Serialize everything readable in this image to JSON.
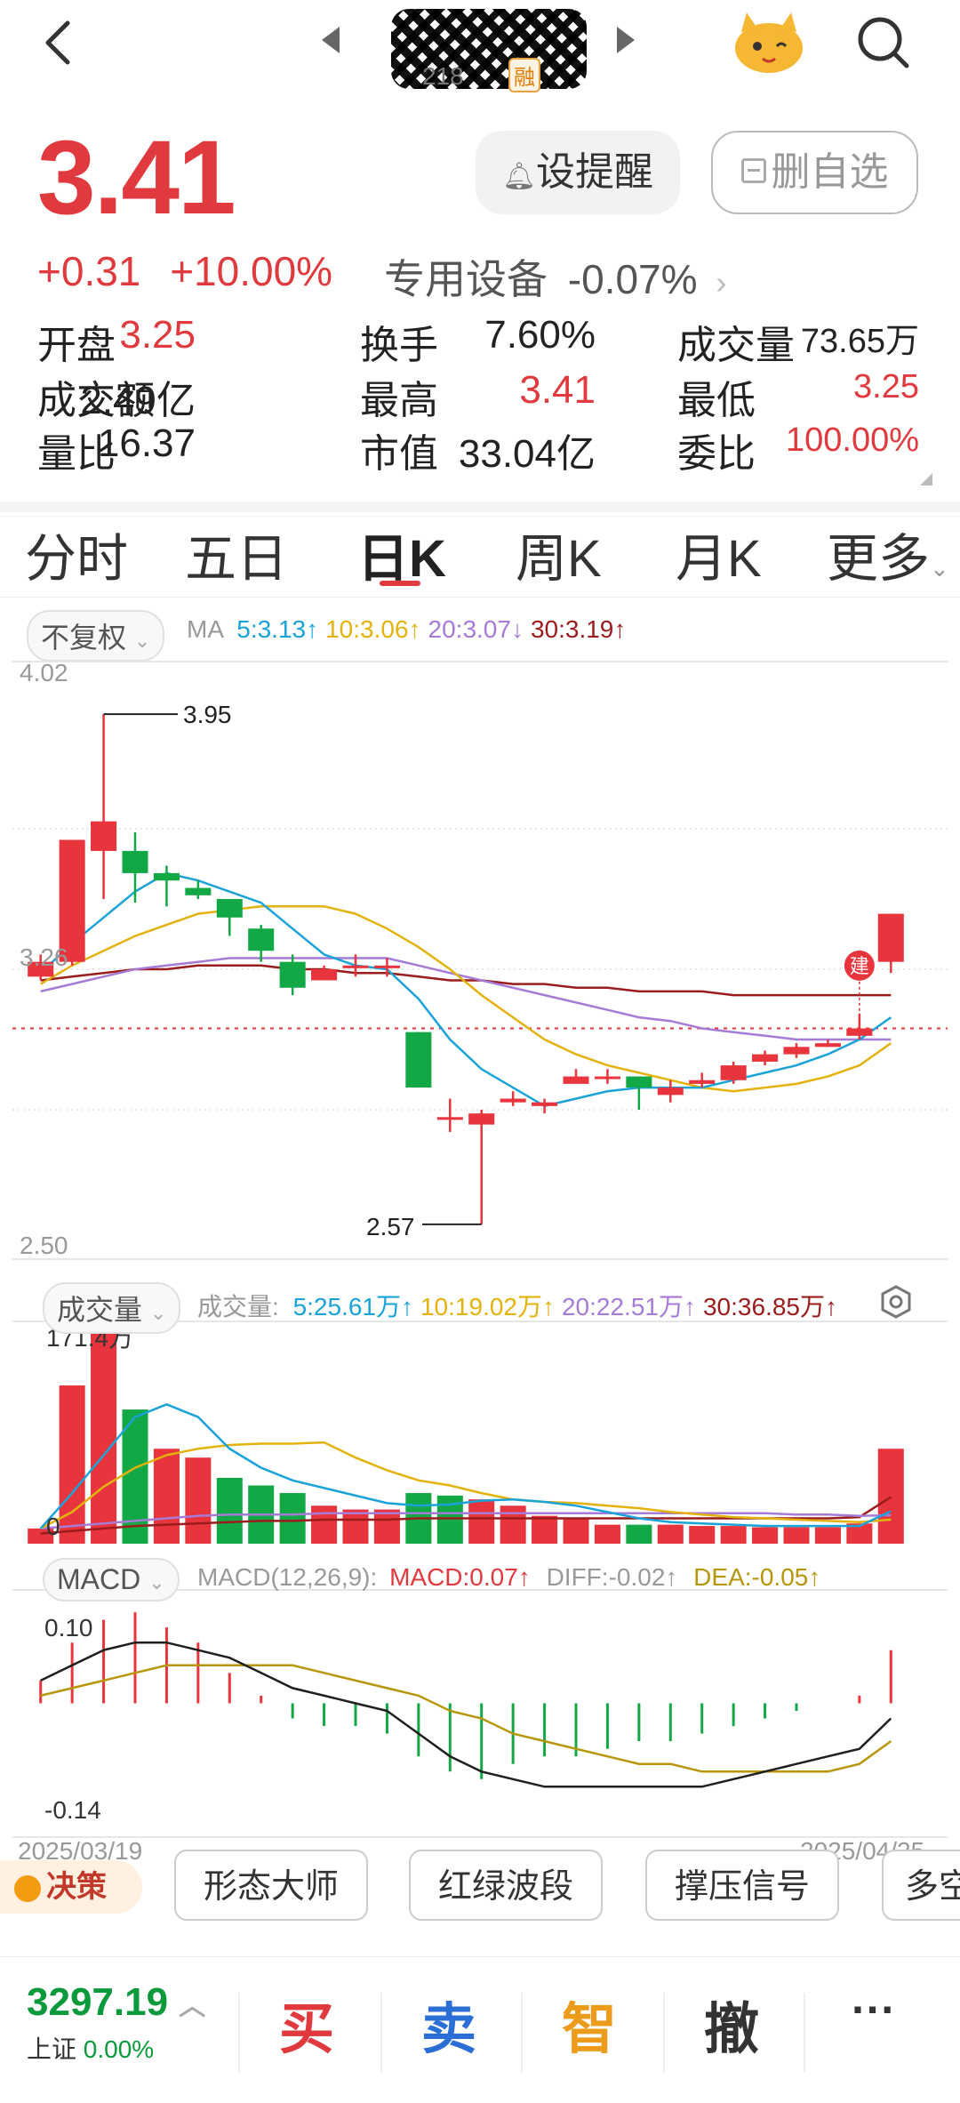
{
  "header": {
    "code_label": "218",
    "rong_badge": "融"
  },
  "quote": {
    "price": "3.41",
    "change": "+0.31",
    "change_pct": "+10.00%",
    "sector": "专用设备",
    "sector_change": "-0.07%",
    "alert_button": "设提醒",
    "remove_button": "删自选"
  },
  "stats": [
    {
      "label": "开盘",
      "value": "3.25",
      "color": "#e03a3e"
    },
    {
      "label": "换手",
      "value": "7.60%",
      "color": "#222222"
    },
    {
      "label": "成交量",
      "value": "73.65万",
      "color": "#222222"
    },
    {
      "label": "成交额",
      "value": "2.49亿",
      "color": "#222222"
    },
    {
      "label": "最高",
      "value": "3.41",
      "color": "#e03a3e"
    },
    {
      "label": "最低",
      "value": "3.25",
      "color": "#e03a3e"
    },
    {
      "label": "量比",
      "value": "16.37",
      "color": "#222222"
    },
    {
      "label": "市值",
      "value": "33.04亿",
      "color": "#222222"
    },
    {
      "label": "委比",
      "value": "100.00%",
      "color": "#e03a3e"
    }
  ],
  "tabs": [
    "分时",
    "五日",
    "日K",
    "周K",
    "月K",
    "更多"
  ],
  "kline": {
    "adjust_label": "不复权",
    "ma_prefix": "MA",
    "ma": [
      {
        "label": "5:3.13",
        "arrow": "↑",
        "color": "#1aa3d9"
      },
      {
        "label": "10:3.06",
        "arrow": "↑",
        "color": "#e3b20c"
      },
      {
        "label": "20:3.07",
        "arrow": "↓",
        "color": "#a57bd6"
      },
      {
        "label": "30:3.19",
        "arrow": "↑",
        "color": "#9b1c1c"
      }
    ],
    "y_max": "4.02",
    "y_mid": "3.26",
    "y_min": "2.50",
    "high_label": "3.95",
    "low_label": "2.57",
    "build_marker": "建"
  },
  "volume": {
    "selector": "成交量",
    "prefix": "成交量:",
    "ma": [
      {
        "label": "5:25.61万",
        "arrow": "↑",
        "color": "#1aa3d9"
      },
      {
        "label": "10:19.02万",
        "arrow": "↑",
        "color": "#e3b20c"
      },
      {
        "label": "20:22.51万",
        "arrow": "↑",
        "color": "#a57bd6"
      },
      {
        "label": "30:36.85万",
        "arrow": "↑",
        "color": "#9b1c1c"
      }
    ],
    "max_label": "171.4万",
    "zero_label": "0"
  },
  "macd": {
    "selector": "MACD",
    "params": "MACD(12,26,9):",
    "macd_value": "MACD:0.07↑",
    "diff_value": "DIFF:-0.02↑",
    "dea_value": "DEA:-0.05↑",
    "y_top": "0.10",
    "y_bottom": "-0.14",
    "date_start": "2025/03/19",
    "date_end": "2025/04/25"
  },
  "strategies": {
    "badge": "决策",
    "items": [
      "形态大师",
      "红绿波段",
      "撑压信号",
      "多空"
    ]
  },
  "bottom": {
    "index_value": "3297.19",
    "index_name": "上证",
    "index_change": "0.00%",
    "buy": "买",
    "sell": "卖",
    "smart": "智",
    "cancel": "撤",
    "more": "···"
  },
  "chart_data": {
    "type": "candlestick",
    "x_start": "2025/03/19",
    "x_end": "2025/04/25",
    "ylim": [
      2.5,
      4.02
    ],
    "candles": [
      {
        "o": 3.24,
        "c": 3.28,
        "h": 3.3,
        "l": 3.23
      },
      {
        "o": 3.28,
        "c": 3.61,
        "h": 3.61,
        "l": 3.27
      },
      {
        "o": 3.58,
        "c": 3.66,
        "h": 3.95,
        "l": 3.45
      },
      {
        "o": 3.58,
        "c": 3.52,
        "h": 3.63,
        "l": 3.44
      },
      {
        "o": 3.52,
        "c": 3.5,
        "h": 3.54,
        "l": 3.43
      },
      {
        "o": 3.48,
        "c": 3.46,
        "h": 3.5,
        "l": 3.45
      },
      {
        "o": 3.45,
        "c": 3.4,
        "h": 3.45,
        "l": 3.35
      },
      {
        "o": 3.37,
        "c": 3.31,
        "h": 3.38,
        "l": 3.28
      },
      {
        "o": 3.28,
        "c": 3.21,
        "h": 3.3,
        "l": 3.19
      },
      {
        "o": 3.23,
        "c": 3.26,
        "h": 3.27,
        "l": 3.23
      },
      {
        "o": 3.27,
        "c": 3.27,
        "h": 3.3,
        "l": 3.24
      },
      {
        "o": 3.27,
        "c": 3.27,
        "h": 3.29,
        "l": 3.24
      },
      {
        "o": 3.09,
        "c": 2.94,
        "h": 3.09,
        "l": 2.94
      },
      {
        "o": 2.86,
        "c": 2.86,
        "h": 2.91,
        "l": 2.82
      },
      {
        "o": 2.84,
        "c": 2.87,
        "h": 2.88,
        "l": 2.57
      },
      {
        "o": 2.9,
        "c": 2.91,
        "h": 2.93,
        "l": 2.89
      },
      {
        "o": 2.89,
        "c": 2.9,
        "h": 2.91,
        "l": 2.87
      },
      {
        "o": 2.95,
        "c": 2.97,
        "h": 2.99,
        "l": 2.95
      },
      {
        "o": 2.97,
        "c": 2.97,
        "h": 2.99,
        "l": 2.95
      },
      {
        "o": 2.97,
        "c": 2.94,
        "h": 2.97,
        "l": 2.88
      },
      {
        "o": 2.92,
        "c": 2.94,
        "h": 2.96,
        "l": 2.9
      },
      {
        "o": 2.95,
        "c": 2.96,
        "h": 2.98,
        "l": 2.94
      },
      {
        "o": 2.96,
        "c": 3.0,
        "h": 3.01,
        "l": 2.95
      },
      {
        "o": 3.01,
        "c": 3.03,
        "h": 3.04,
        "l": 3.0
      },
      {
        "o": 3.03,
        "c": 3.05,
        "h": 3.06,
        "l": 3.02
      },
      {
        "o": 3.05,
        "c": 3.06,
        "h": 3.07,
        "l": 3.05
      },
      {
        "o": 3.08,
        "c": 3.1,
        "h": 3.14,
        "l": 3.07
      },
      {
        "o": 3.28,
        "c": 3.41,
        "h": 3.41,
        "l": 3.25
      }
    ],
    "ma5": [
      3.25,
      3.33,
      3.4,
      3.47,
      3.52,
      3.5,
      3.47,
      3.44,
      3.37,
      3.3,
      3.27,
      3.26,
      3.18,
      3.07,
      2.99,
      2.94,
      2.89,
      2.91,
      2.93,
      2.94,
      2.94,
      2.94,
      2.96,
      2.98,
      3.0,
      3.03,
      3.07,
      3.13
    ],
    "ma10": [
      3.22,
      3.27,
      3.31,
      3.35,
      3.38,
      3.41,
      3.42,
      3.43,
      3.43,
      3.43,
      3.41,
      3.37,
      3.32,
      3.26,
      3.19,
      3.13,
      3.07,
      3.03,
      3.0,
      2.98,
      2.96,
      2.94,
      2.93,
      2.94,
      2.95,
      2.97,
      3.0,
      3.06
    ],
    "ma20": [
      3.2,
      3.22,
      3.24,
      3.26,
      3.27,
      3.28,
      3.29,
      3.29,
      3.29,
      3.29,
      3.29,
      3.29,
      3.27,
      3.25,
      3.23,
      3.21,
      3.19,
      3.17,
      3.15,
      3.13,
      3.12,
      3.1,
      3.09,
      3.08,
      3.07,
      3.07,
      3.07,
      3.07
    ],
    "ma30": [
      3.23,
      3.24,
      3.25,
      3.26,
      3.26,
      3.27,
      3.27,
      3.27,
      3.26,
      3.26,
      3.25,
      3.25,
      3.24,
      3.23,
      3.23,
      3.22,
      3.22,
      3.21,
      3.21,
      3.2,
      3.2,
      3.2,
      3.19,
      3.19,
      3.19,
      3.19,
      3.19,
      3.19
    ],
    "volume": [
      12,
      125,
      171.4,
      106,
      75,
      68,
      52,
      46,
      40,
      30,
      27,
      27,
      40,
      38,
      35,
      30,
      22,
      20,
      15,
      15,
      15,
      14,
      14,
      13,
      13,
      13,
      16,
      75
    ],
    "volume_up": [
      true,
      true,
      true,
      false,
      true,
      true,
      false,
      false,
      false,
      true,
      true,
      true,
      false,
      false,
      true,
      true,
      true,
      true,
      true,
      false,
      true,
      true,
      true,
      true,
      true,
      true,
      true,
      true
    ],
    "vol_ma5": [
      12,
      40,
      70,
      100,
      110,
      100,
      75,
      60,
      50,
      44,
      38,
      32,
      30,
      31,
      34,
      35,
      33,
      30,
      25,
      20,
      17,
      16,
      15,
      14,
      14,
      14,
      14,
      25.61
    ],
    "vol_ma10": [
      12,
      25,
      45,
      60,
      70,
      75,
      78,
      79,
      79,
      80,
      68,
      58,
      50,
      46,
      40,
      35,
      33,
      32,
      30,
      28,
      25,
      23,
      21,
      20,
      19,
      18,
      17,
      19.02
    ],
    "vol_ma20": [
      12,
      14,
      16,
      18,
      20,
      22,
      23,
      23,
      23,
      24,
      24,
      24,
      24,
      24,
      24,
      24,
      24,
      24,
      24,
      24,
      24,
      24,
      24,
      24,
      23,
      23,
      22,
      22.51
    ],
    "vol_ma30": [
      8,
      10,
      12,
      14,
      15,
      16,
      17,
      18,
      18,
      19,
      19,
      19,
      20,
      20,
      20,
      20,
      20,
      20,
      20,
      20,
      20,
      20,
      20,
      20,
      20,
      20,
      21,
      36.85
    ],
    "macd_hist": [
      0.03,
      0.08,
      0.11,
      0.12,
      0.1,
      0.08,
      0.04,
      0.01,
      -0.02,
      -0.03,
      -0.03,
      -0.04,
      -0.07,
      -0.09,
      -0.1,
      -0.08,
      -0.07,
      -0.07,
      -0.06,
      -0.05,
      -0.05,
      -0.04,
      -0.03,
      -0.02,
      -0.01,
      0.0,
      0.01,
      0.07
    ],
    "diff": [
      0.03,
      0.05,
      0.07,
      0.08,
      0.08,
      0.07,
      0.06,
      0.04,
      0.02,
      0.01,
      0.0,
      -0.01,
      -0.04,
      -0.07,
      -0.09,
      -0.1,
      -0.11,
      -0.11,
      -0.11,
      -0.11,
      -0.11,
      -0.11,
      -0.1,
      -0.09,
      -0.08,
      -0.07,
      -0.06,
      -0.02
    ],
    "dea": [
      0.01,
      0.02,
      0.03,
      0.04,
      0.05,
      0.05,
      0.05,
      0.05,
      0.05,
      0.04,
      0.03,
      0.02,
      0.01,
      -0.01,
      -0.02,
      -0.04,
      -0.05,
      -0.06,
      -0.07,
      -0.08,
      -0.08,
      -0.09,
      -0.09,
      -0.09,
      -0.09,
      -0.09,
      -0.08,
      -0.05
    ]
  }
}
